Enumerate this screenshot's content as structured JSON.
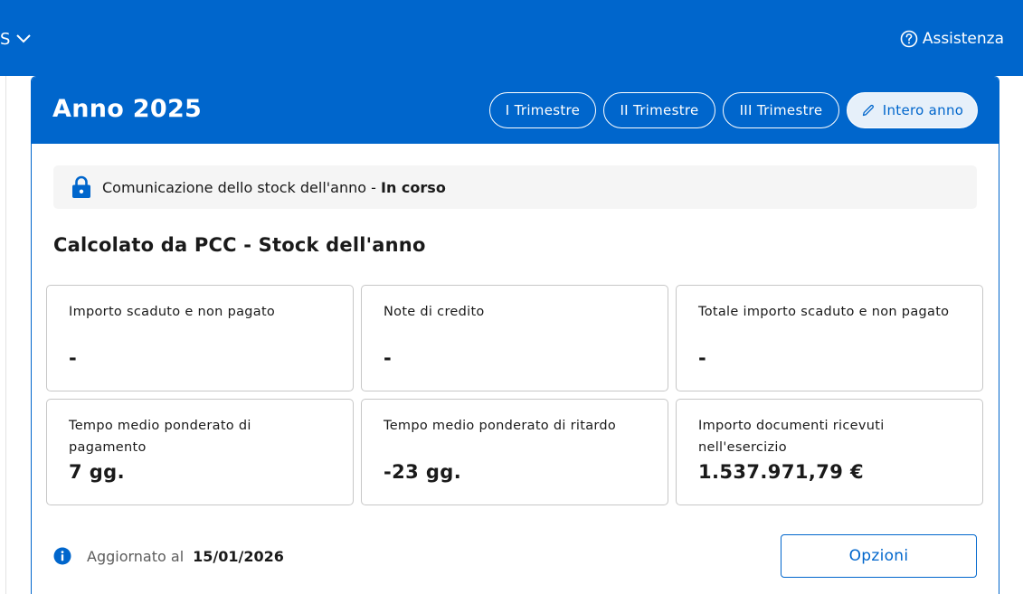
{
  "topbar": {
    "left_label": "S",
    "help_label": "Assistenza"
  },
  "card": {
    "year_title": "Anno 2025",
    "tabs": [
      {
        "label": "I Trimestre",
        "active": false
      },
      {
        "label": "II Trimestre",
        "active": false
      },
      {
        "label": "III Trimestre",
        "active": false
      },
      {
        "label": "Intero anno",
        "active": true
      }
    ],
    "status": {
      "text": "Comunicazione dello stock dell'anno",
      "separator": " - ",
      "state": "In corso"
    },
    "section_title": "Calcolato da PCC - Stock dell'anno",
    "tiles": [
      {
        "label": "Importo scaduto e non pagato",
        "value": "-"
      },
      {
        "label": "Note di credito",
        "value": "-"
      },
      {
        "label": "Totale importo scaduto e non pagato",
        "value": "-"
      },
      {
        "label": "Tempo medio ponderato di pagamento",
        "value": "7 gg."
      },
      {
        "label": "Tempo medio ponderato di ritardo",
        "value": "-23 gg."
      },
      {
        "label": "Importo documenti ricevuti nell'esercizio",
        "value": "1.537.971,79 €"
      }
    ],
    "footer": {
      "updated_label": "Aggiornato al",
      "updated_date": "15/01/2026",
      "options_label": "Opzioni"
    }
  },
  "colors": {
    "primary": "#0066cc",
    "active_tab_bg": "#e6f0fa",
    "status_bg": "#f5f5f5",
    "tile_border": "#c7c7c7"
  }
}
